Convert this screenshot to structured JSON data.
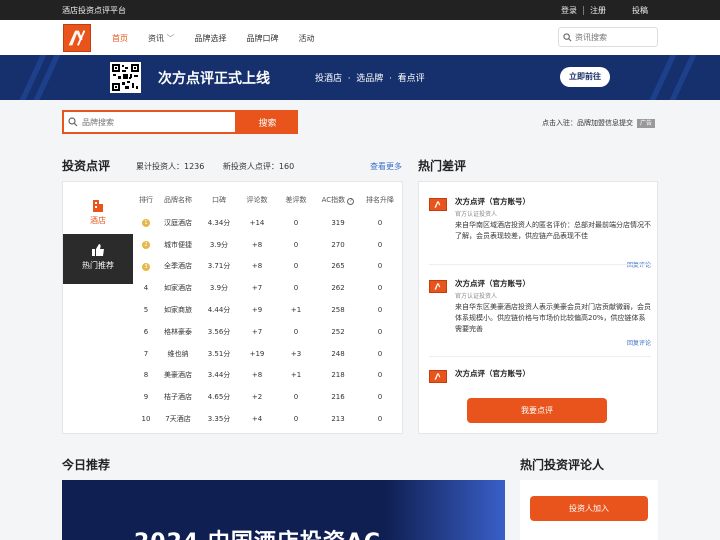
{
  "topbar": {
    "site_name": "酒店投资点评平台",
    "login": "登录",
    "register": "注册",
    "submit": "投稿"
  },
  "nav": {
    "items": [
      {
        "label": "首页",
        "active": true
      },
      {
        "label": "资讯",
        "dropdown": true
      },
      {
        "label": "品牌选择"
      },
      {
        "label": "品牌口碑"
      },
      {
        "label": "活动"
      }
    ],
    "search_placeholder": "资讯搜索"
  },
  "banner": {
    "title": "次方点评正式上线",
    "slogan": "投酒店  ·  选品牌  ·  看点评",
    "button": "立即前往"
  },
  "brand_search": {
    "placeholder": "品牌搜索",
    "button": "搜索"
  },
  "entry": {
    "text": "点击入驻：品牌加盟信息提交",
    "ad": "广告"
  },
  "invest": {
    "title": "投资点评",
    "total_investors": "累计投资人：1236",
    "new_reviews": "新投资人点评：160",
    "more": "查看更多",
    "categories": [
      "酒店",
      "热门推荐"
    ],
    "columns": [
      "排行",
      "品牌名称",
      "口碑",
      "评论数",
      "差评数",
      "AC指数",
      "排名升降"
    ],
    "rows": [
      [
        "1",
        "汉庭酒店",
        "4.34分",
        "+14",
        "0",
        "319",
        "0"
      ],
      [
        "2",
        "城市便捷",
        "3.9分",
        "+8",
        "0",
        "270",
        "0"
      ],
      [
        "3",
        "全季酒店",
        "3.71分",
        "+8",
        "0",
        "265",
        "0"
      ],
      [
        "4",
        "如家酒店",
        "3.9分",
        "+7",
        "0",
        "262",
        "0"
      ],
      [
        "5",
        "如家商旅",
        "4.44分",
        "+9",
        "+1",
        "258",
        "0"
      ],
      [
        "6",
        "格林豪泰",
        "3.56分",
        "+7",
        "0",
        "252",
        "0"
      ],
      [
        "7",
        "维也纳",
        "3.51分",
        "+19",
        "+3",
        "248",
        "0"
      ],
      [
        "8",
        "美豪酒店",
        "3.44分",
        "+8",
        "+1",
        "218",
        "0"
      ],
      [
        "9",
        "桔子酒店",
        "4.65分",
        "+2",
        "0",
        "216",
        "0"
      ],
      [
        "10",
        "7天酒店",
        "3.35分",
        "+4",
        "0",
        "213",
        "0"
      ]
    ]
  },
  "hot_bad": {
    "title": "热门差评",
    "reviews": [
      {
        "name": "次方点评（官方账号）",
        "tag": "官方认证投资人",
        "text": "来自华南区域酒店投资人的匿名评价：总部对最前端分店情况不了解，会员表现较差，供应链产品表现不佳",
        "reply": "回复评论"
      },
      {
        "name": "次方点评（官方账号）",
        "tag": "官方认证投资人",
        "text": "来自华东区美豪酒店投资人表示美豪会员对门店贡献微弱，会员体系规模小。供应链价格与市场价比较偏高20%，供应链体系需要完善",
        "reply": "回复评论"
      },
      {
        "name": "次方点评（官方账号）",
        "tag": "",
        "text": "",
        "reply": ""
      }
    ],
    "button": "我要点评"
  },
  "today": {
    "title": "今日推荐",
    "image_text": "2024 中国酒店投资AC"
  },
  "commentators": {
    "title": "热门投资评论人",
    "button": "投资人加入"
  },
  "colors": {
    "brand": "#e8541c",
    "banner": "#16306e",
    "link": "#3b6fc9"
  }
}
